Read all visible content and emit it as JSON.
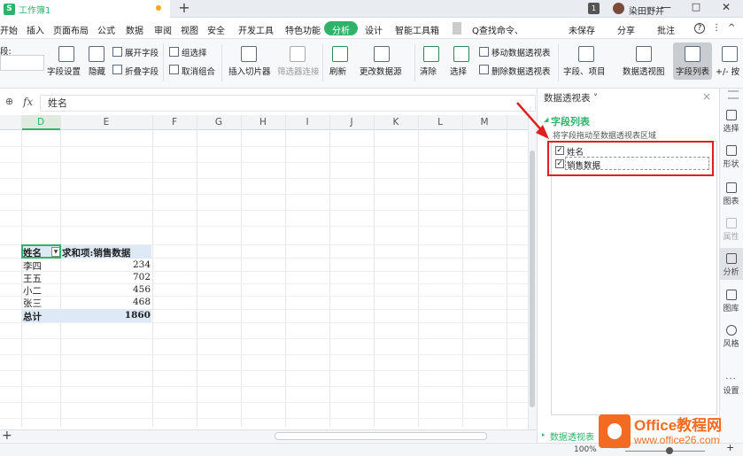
{
  "titlebar": {
    "wps_logo": "S",
    "doc_name": "工作簿1",
    "new_tab": "+",
    "badge": "1",
    "user_name": "染田野并",
    "min": "—",
    "max": "□",
    "close": "✕"
  },
  "menu": {
    "items": [
      "开始",
      "插入",
      "页面布局",
      "公式",
      "数据",
      "审阅",
      "视图",
      "安全",
      "开发工具",
      "特色功能",
      "分析",
      "设计",
      "智能工具箱"
    ],
    "active": "分析",
    "search": "Q查找命令、",
    "unsaved": "未保存",
    "share": "分享",
    "comment": "批注",
    "help": "?",
    "more": "⋮",
    "collapse": "^"
  },
  "ribbon": {
    "field_label": "段:",
    "field_settings": "字段设置",
    "hide": "隐藏",
    "expand_field": "展开字段",
    "collapse_field": "折叠字段",
    "group_select": "组选择",
    "ungroup": "取消组合",
    "insert_slicer": "插入切片器",
    "filter_conn": "筛选器连接",
    "refresh": "刷新",
    "change_source": "更改数据源",
    "clear": "清除",
    "select": "选择",
    "move_pivot": "移动数据透视表",
    "delete_pivot": "删除数据透视表",
    "fields_items": "字段、项目",
    "pivot_chart": "数据透视图",
    "field_list": "字段列表",
    "plus_minus": "+/- 按"
  },
  "formula_bar": {
    "zoom_icon": "⊕",
    "fx": "fx",
    "value": "姓名"
  },
  "columns": [
    "D",
    "E",
    "F",
    "G",
    "H",
    "I",
    "J",
    "K",
    "L",
    "M"
  ],
  "pivot": {
    "header_name": "姓名",
    "header_sum": "求和项:销售数据",
    "rows": [
      {
        "name": "李四",
        "value": "234"
      },
      {
        "name": "王五",
        "value": "702"
      },
      {
        "name": "小二",
        "value": "456"
      },
      {
        "name": "张三",
        "value": "468"
      }
    ],
    "total_label": "总计",
    "total_value": "1860"
  },
  "panel": {
    "title": "数据透视表 ˅",
    "close": "×",
    "section_title": "字段列表",
    "hint": "将字段拖动至数据透视表区域",
    "fields": [
      "姓名",
      "销售数据"
    ],
    "checked": [
      true,
      true
    ],
    "bottom_section": "数据透视表"
  },
  "right_bar": [
    "选择",
    "形状",
    "图表",
    "属性",
    "分析",
    "图库",
    "风格",
    "设置"
  ],
  "status": {
    "zoom": "100% ˅",
    "minus": "—",
    "plus": "+"
  },
  "watermark": {
    "line1": "Office教程网",
    "line2": "www.office26.com"
  },
  "colors": {
    "accent_green": "#2fb36a",
    "highlight_red": "#e02020",
    "logo_orange": "#f36b21"
  }
}
